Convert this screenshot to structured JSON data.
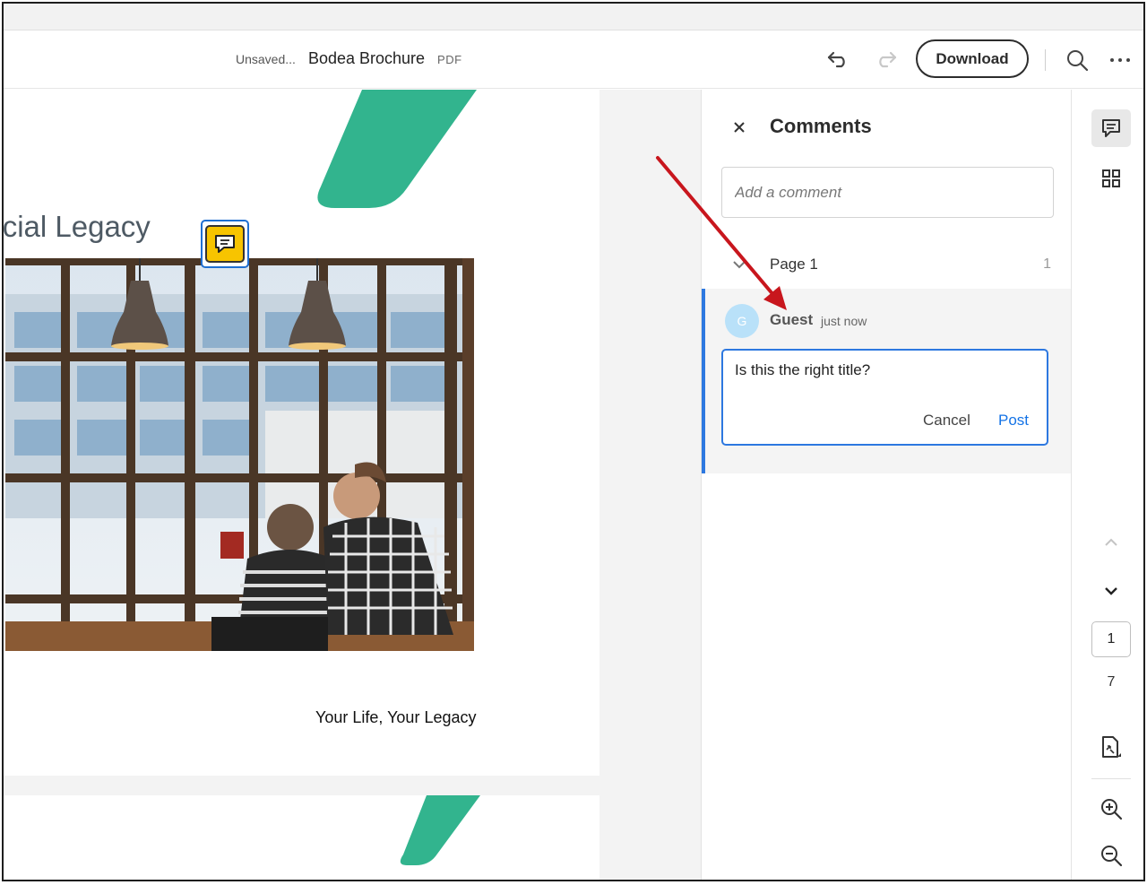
{
  "header": {
    "save_status": "Unsaved...",
    "doc_name": "Bodea Brochure",
    "doc_type": "PDF",
    "download_label": "Download",
    "undo_icon": "undo-icon",
    "redo_icon": "redo-icon",
    "search_icon": "search-icon",
    "more_icon": "more-icon"
  },
  "document": {
    "heading": "ancial Legacy",
    "tagline": "Your Life, Your Legacy",
    "accent_color": "#32b48e",
    "pin_color": "#f7c400"
  },
  "comments": {
    "title": "Comments",
    "add_placeholder": "Add a comment",
    "group": {
      "label": "Page 1",
      "count": "1"
    },
    "card": {
      "avatar_initial": "G",
      "author": "Guest",
      "timestamp": "just now",
      "reply_text": "Is this the right title?",
      "cancel_label": "Cancel",
      "post_label": "Post"
    },
    "accent_color": "#2d78e0"
  },
  "rail": {
    "current_page": "1",
    "total_pages": "7"
  }
}
